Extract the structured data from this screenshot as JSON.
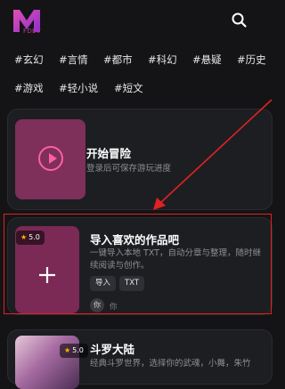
{
  "header": {
    "logo_text": "M",
    "logo_sub": "FDEV",
    "search_icon": "search-icon"
  },
  "tags": [
    {
      "label": "#玄幻"
    },
    {
      "label": "#言情"
    },
    {
      "label": "#都市"
    },
    {
      "label": "#科幻"
    },
    {
      "label": "#悬疑"
    },
    {
      "label": "#历史"
    },
    {
      "label": "#游戏"
    },
    {
      "label": "#轻小说"
    },
    {
      "label": "#短文"
    }
  ],
  "start_card": {
    "title": "开始冒险",
    "subtitle": "登录后可保存游玩进度",
    "icon": "play-icon"
  },
  "import_card": {
    "rating": "5.0",
    "title": "导入喜欢的作品吧",
    "description": "一键导入本地 TXT，自动分章与整理，随时继续阅读与创作。",
    "chips": [
      "导入",
      "TXT"
    ],
    "avatar_text": "你",
    "author": "你",
    "icon": "plus-icon"
  },
  "story_card": {
    "rating": "5.0",
    "title": "斗罗大陆",
    "description": "经典斗罗世界，选择你的武魂，小舞，朱竹"
  },
  "colors": {
    "background": "#141416",
    "card": "#1d1e22",
    "accent": "#ff5fa2",
    "annotation": "#e02222"
  }
}
